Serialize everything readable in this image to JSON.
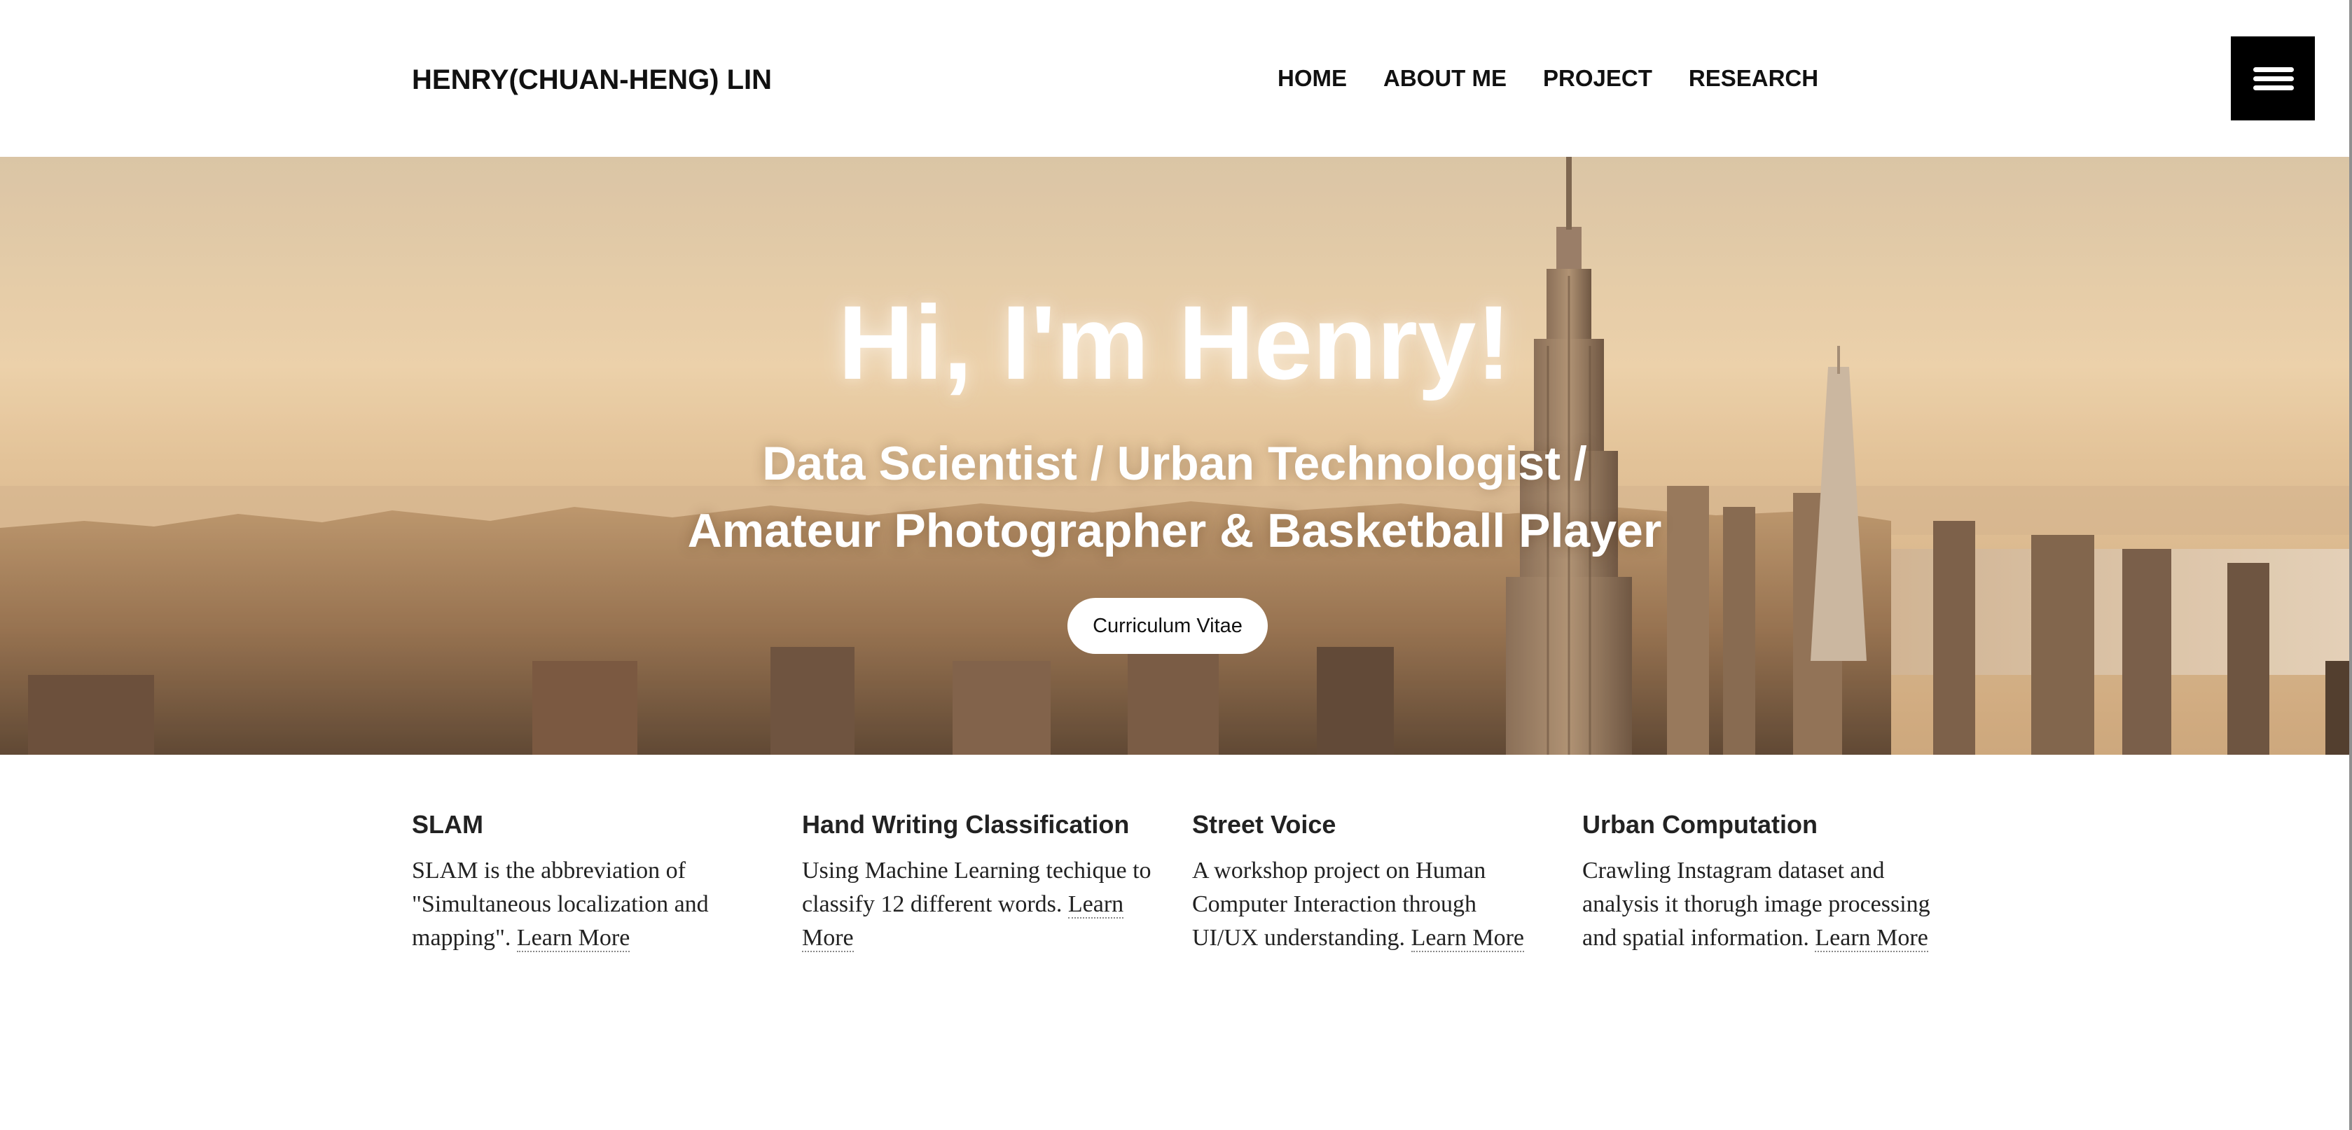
{
  "header": {
    "brand": "HENRY(CHUAN-HENG) LIN",
    "nav": [
      {
        "label": "HOME"
      },
      {
        "label": "ABOUT ME"
      },
      {
        "label": "PROJECT"
      },
      {
        "label": "RESEARCH"
      }
    ],
    "menu_icon": "hamburger-menu-icon"
  },
  "hero": {
    "title": "Hi, I'm Henry!",
    "subtitle_line1": "Data Scientist / Urban Technologist /",
    "subtitle_line2": "Amateur Photographer & Basketball Player",
    "cv_button": "Curriculum Vitae",
    "background": "New York City skyline with Empire State Building at sunset"
  },
  "projects": [
    {
      "title": "SLAM",
      "description": "SLAM is the abbreviation of \"Simultaneous localization and mapping\".",
      "link": "Learn More"
    },
    {
      "title": "Hand Writing Classification",
      "description": "Using Machine Learning techique to classify 12 different words.",
      "link": "Learn More"
    },
    {
      "title": "Street Voice",
      "description": "A workshop project on Human Computer Interaction through UI/UX understanding.",
      "link": "Learn More"
    },
    {
      "title": "Urban Computation",
      "description": "Crawling Instagram dataset and analysis it thorugh image processing and spatial information.",
      "link": "Learn More"
    }
  ],
  "colors": {
    "text": "#222222",
    "menu_button": "#000000",
    "hero_tint": "#d9b98c"
  }
}
